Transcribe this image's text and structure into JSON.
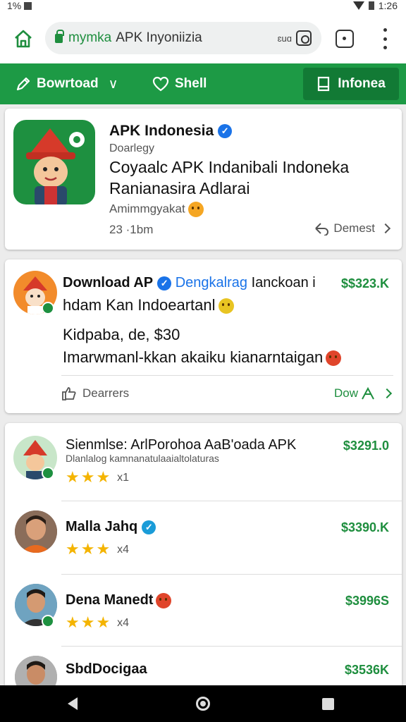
{
  "status_bar": {
    "left_text": "1%",
    "time": "1:26"
  },
  "browser": {
    "url_host": "mymka",
    "url_path": "APK Inyoniizia",
    "url_side_text": "ɛuɑ"
  },
  "nav": {
    "download_label": "Bowrtoad",
    "download_caret": "∨",
    "shell_label": "Shell",
    "active_label": "Infonea"
  },
  "featured": {
    "title": "APK Indonesia",
    "subtitle": "Doarlegy",
    "headline_1": "Coyaalc APK Indanibali Indoneka",
    "headline_2": "Ranianasira Adlarai",
    "tagline": "Amimmgyakat",
    "meta_left": "23 ·1bm",
    "meta_right": "Demest"
  },
  "post": {
    "title": "Download AP",
    "link_text": "Dengkalrag",
    "title_tail": "Ianckoan i",
    "price": "$$323.K",
    "line2": "hdam Kan Indoeartanl",
    "line3": "Kidpaba, de, $30",
    "line4": "Imarwmanl-kkan akaiku kianarntaigan",
    "action_left": "Dearrers",
    "action_right": "Dow"
  },
  "list": [
    {
      "name": "Sienmlse: ArlPorohoa AaB'oada APK",
      "sub": "Dlanlalog kamnanatulaaialtolaturas",
      "stars": "★★★",
      "count": "x1",
      "price": "$3291.0"
    },
    {
      "name": "Malla Jahq",
      "stars": "★★★",
      "count": "x4",
      "price": "$3390.K"
    },
    {
      "name": "Dena Manedt",
      "stars": "★★★",
      "count": "x4",
      "price": "$3996S"
    },
    {
      "name": "SbdDocigaa",
      "price": "$3536K"
    }
  ],
  "colors": {
    "brand_green": "#1d9a45",
    "price_green": "#1e8e3e",
    "verified_blue": "#1a73e8",
    "star_gold": "#f4b400"
  }
}
